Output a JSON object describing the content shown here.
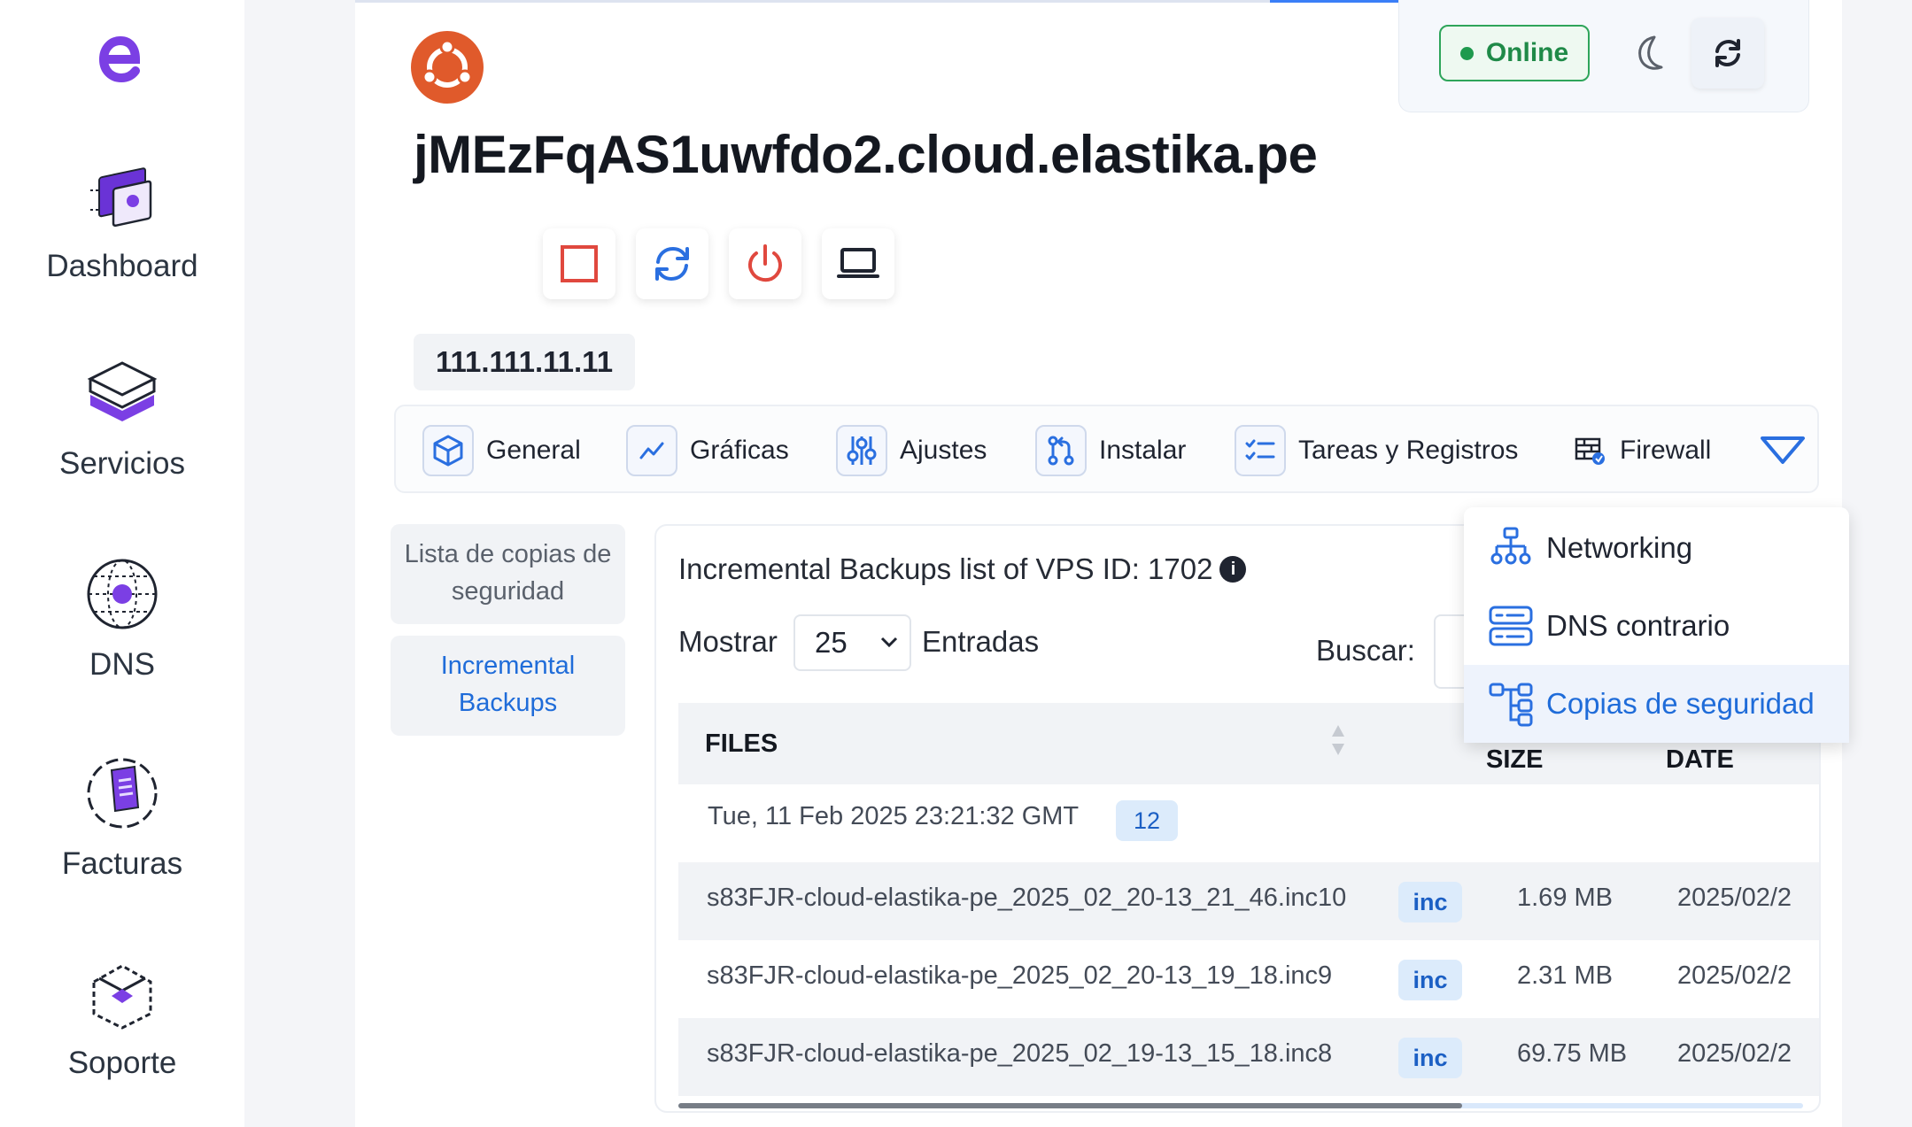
{
  "sidebar": {
    "items": [
      {
        "label": "Dashboard",
        "icon": "dashboard-icon"
      },
      {
        "label": "Servicios",
        "icon": "servers-icon"
      },
      {
        "label": "DNS",
        "icon": "globe-icon"
      },
      {
        "label": "Facturas",
        "icon": "invoice-icon"
      },
      {
        "label": "Soporte",
        "icon": "support-icon"
      }
    ]
  },
  "header": {
    "status": "Online",
    "hostname": "jMEzFqAS1uwfdo2.cloud.elastika.pe",
    "ip": "111.111.11.11",
    "os_icon": "ubuntu-icon"
  },
  "tabs": [
    {
      "label": "General",
      "icon": "cube-icon"
    },
    {
      "label": "Gráficas",
      "icon": "chart-line-icon"
    },
    {
      "label": "Ajustes",
      "icon": "sliders-icon"
    },
    {
      "label": "Instalar",
      "icon": "git-icon"
    },
    {
      "label": "Tareas y Registros",
      "icon": "checklist-icon"
    },
    {
      "label": "Firewall",
      "icon": "firewall-icon"
    }
  ],
  "dropdown": {
    "items": [
      {
        "label": "Networking",
        "icon": "network-icon"
      },
      {
        "label": "DNS contrario",
        "icon": "server-stack-icon"
      },
      {
        "label": "Copias de seguridad",
        "icon": "backup-tree-icon",
        "active": true
      }
    ]
  },
  "subnav": {
    "backup_list": "Lista de copias de seguridad",
    "incremental": "Incremental Backups"
  },
  "content": {
    "title": "Incremental Backups list of VPS ID: 1702",
    "show_label": "Mostrar",
    "page_size": "25",
    "entries_label": "Entradas",
    "search_label": "Buscar:",
    "columns": {
      "files": "FILES",
      "size": "SIZE",
      "date": "DATE"
    },
    "group": {
      "date": "Tue, 11 Feb 2025 23:21:32 GMT",
      "count": "12"
    },
    "rows": [
      {
        "file": "s83FJR-cloud-elastika-pe_2025_02_20-13_21_46.inc10",
        "type": "inc",
        "size": "1.69 MB",
        "date": "2025/02/2"
      },
      {
        "file": "s83FJR-cloud-elastika-pe_2025_02_20-13_19_18.inc9",
        "type": "inc",
        "size": "2.31 MB",
        "date": "2025/02/2"
      },
      {
        "file": "s83FJR-cloud-elastika-pe_2025_02_19-13_15_18.inc8",
        "type": "inc",
        "size": "69.75 MB",
        "date": "2025/02/2"
      }
    ]
  },
  "colors": {
    "brand": "#7b3fe4",
    "accent": "#1f6cd9",
    "danger": "#e0483e",
    "online": "#1f8a48",
    "ubuntu": "#e05a2b"
  }
}
